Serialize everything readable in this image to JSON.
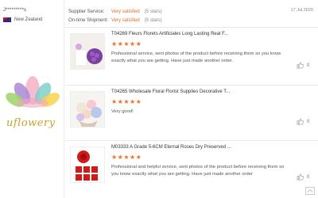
{
  "buyer": {
    "name": "J*********s",
    "country": "New Zealand"
  },
  "logo_text": "uflowery",
  "ratings": [
    {
      "label": "Supplier Service:",
      "value": "Very satisfied",
      "stars": "(5 stars)"
    },
    {
      "label": "On-time Shipment:",
      "value": "Very satisfied",
      "stars": "(5 stars)"
    }
  ],
  "date": "17 Jul 2020",
  "reviews": [
    {
      "title": "T04269 Fleurs Florets Artificiales Long Lasting Real F...",
      "stars": "★★★★★",
      "comment": "Professional service, sent photos of the product before receiving them so you know exactly what you are getting. Have just made another order.",
      "likes": "0",
      "image_icon": "purple-rose-bouquet"
    },
    {
      "title": "T04265 Wholesale Floral Florist Supplies Decorative T...",
      "stars": "★★★★★",
      "comment": "Very good!",
      "likes": "0",
      "image_icon": "pastel-flower-bouquet"
    },
    {
      "title": "M03333 A Grade 5-6CM Eternal Roses Dry Preserved ...",
      "stars": "★★★★★",
      "comment": "Professional and helpful service, sent photos of the product before receiving them so you know exactly what you are getting. Have just made another order",
      "likes": "0",
      "image_icon": "red-preserved-roses"
    }
  ],
  "colors": {
    "accent": "#f26e21",
    "satisfied": "#e06c2a",
    "logo_gold": "#c9a12b"
  }
}
